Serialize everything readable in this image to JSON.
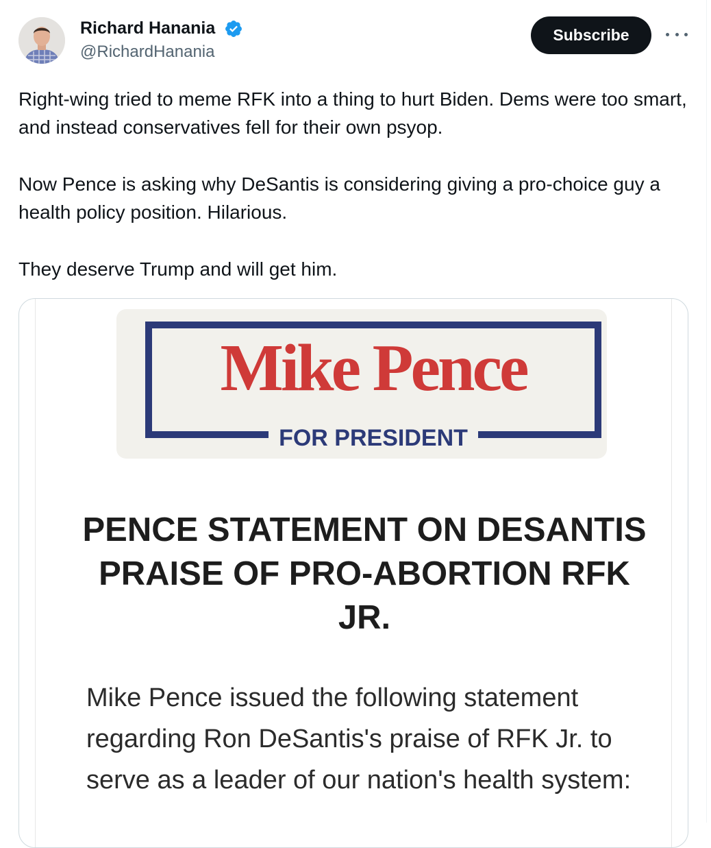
{
  "author": {
    "display_name": "Richard Hanania",
    "handle": "@RichardHanania",
    "verified": true
  },
  "actions": {
    "subscribe_label": "Subscribe",
    "more_icon": "more-horizontal-icon"
  },
  "tweet": {
    "paragraphs": [
      "Right-wing tried to meme RFK into a thing to hurt Biden. Dems were too smart, and instead conservatives fell for their own psyop.",
      "Now Pence is asking why DeSantis is considering giving a pro-choice guy a health policy position. Hilarious.",
      "They deserve Trump and will get him."
    ]
  },
  "media": {
    "logo_name": "Mike Pence",
    "logo_subtitle": "FOR PRESIDENT",
    "headline": "PENCE STATEMENT ON DESANTIS PRAISE OF PRO-ABORTION RFK JR.",
    "body": "Mike Pence issued the following statement regarding Ron DeSantis's praise of RFK Jr. to serve as a leader of our nation's health system:"
  },
  "colors": {
    "text_primary": "#0f1419",
    "text_secondary": "#536471",
    "verified_blue": "#1d9bf0",
    "button_bg": "#0f1419",
    "logo_red": "#cf3a38",
    "logo_navy": "#2c3a78"
  }
}
